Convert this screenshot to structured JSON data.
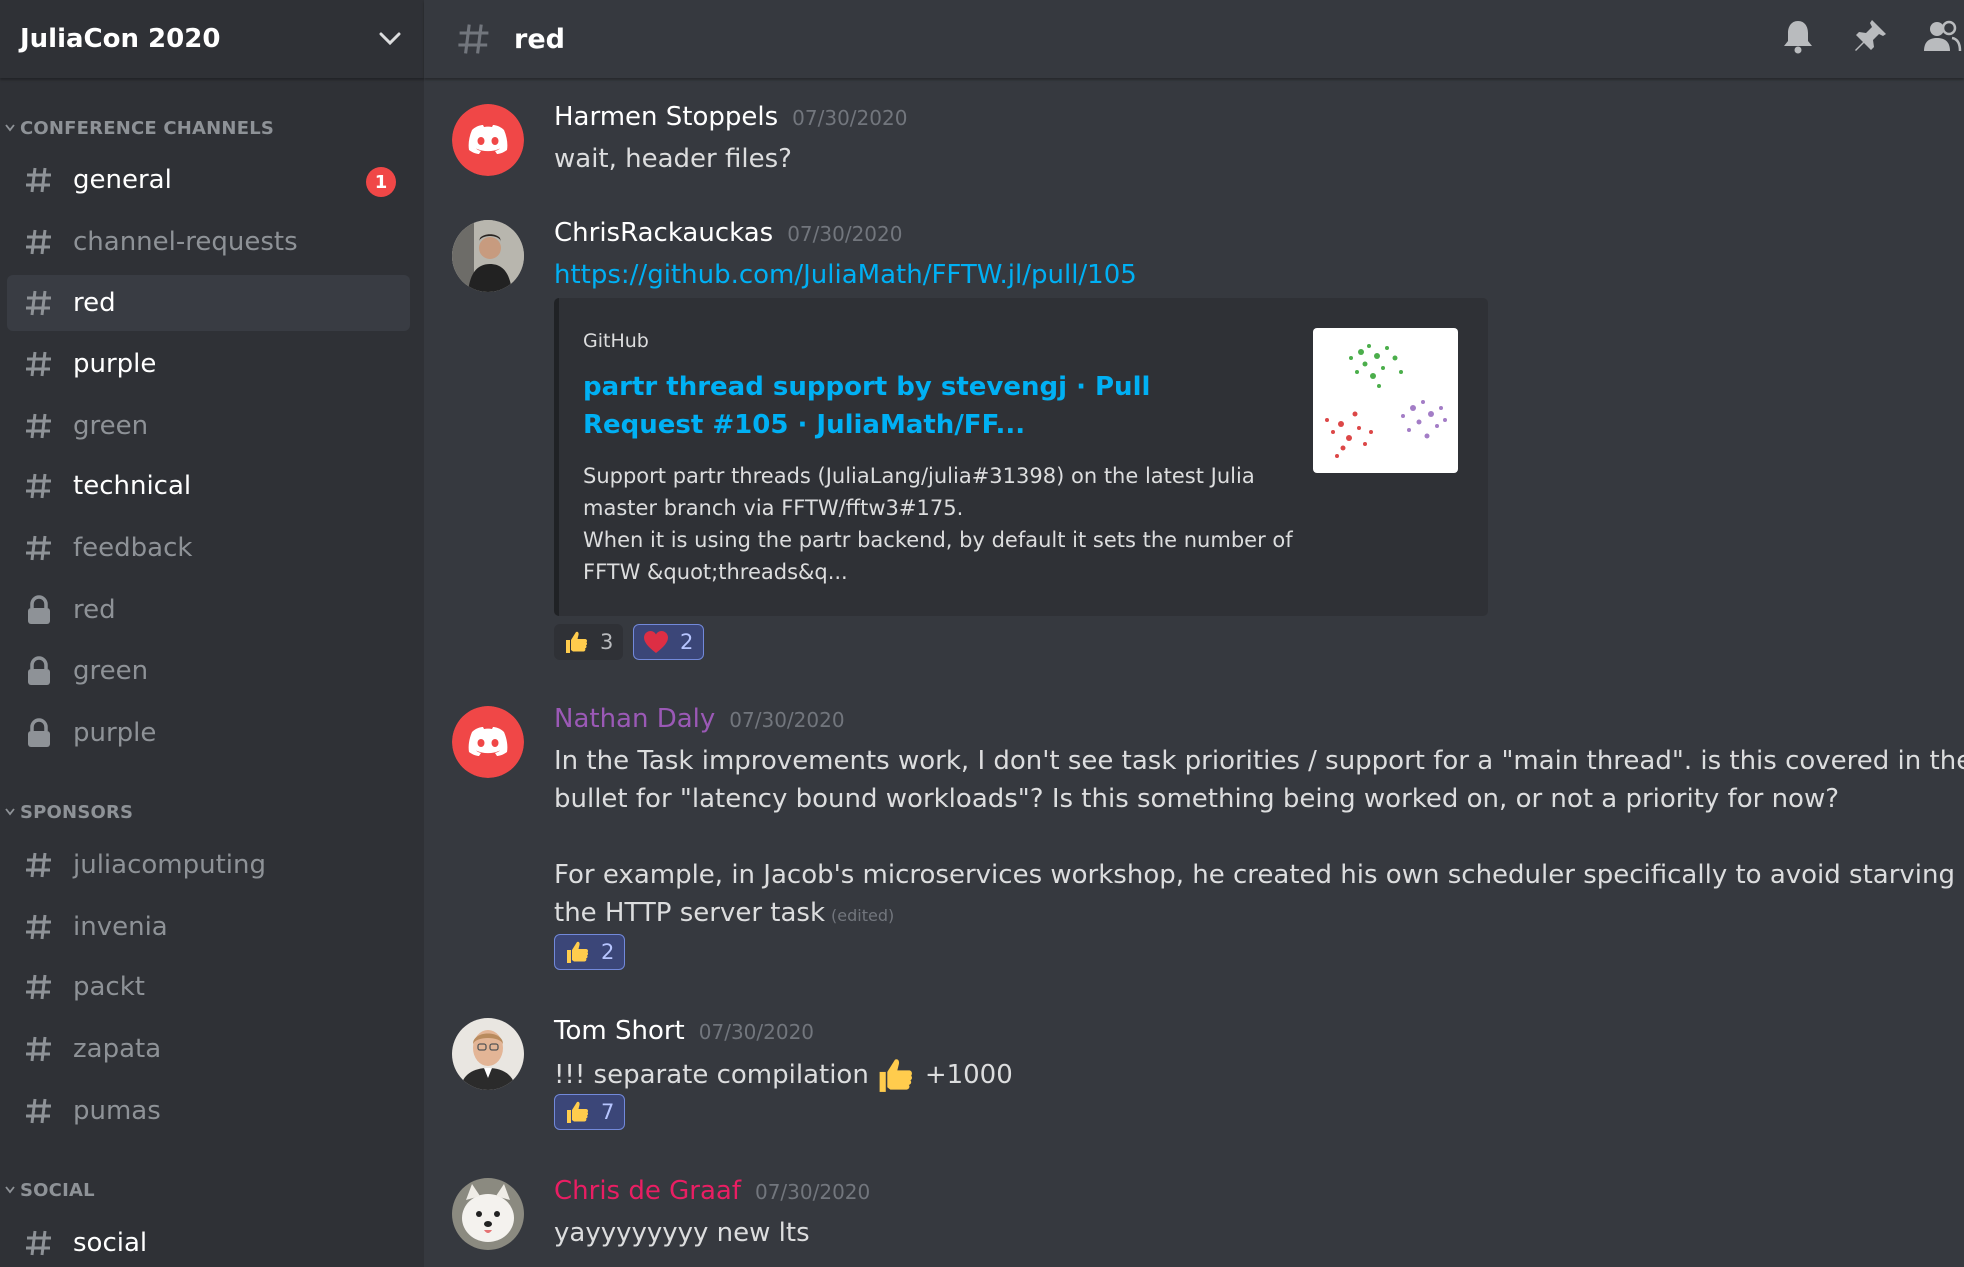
{
  "server": {
    "name": "JuliaCon 2020"
  },
  "sidebar": {
    "categories": [
      {
        "label": "CONFERENCE CHANNELS",
        "channels": [
          {
            "name": "general",
            "icon": "hash-icon",
            "badge": "1"
          },
          {
            "name": "channel-requests",
            "icon": "hash-icon"
          },
          {
            "name": "red",
            "icon": "hash-icon",
            "active": true
          },
          {
            "name": "purple",
            "icon": "hash-icon"
          },
          {
            "name": "green",
            "icon": "hash-icon"
          },
          {
            "name": "technical",
            "icon": "hash-icon"
          },
          {
            "name": "feedback",
            "icon": "hash-icon"
          },
          {
            "name": "red",
            "icon": "lock-icon"
          },
          {
            "name": "green",
            "icon": "lock-icon"
          },
          {
            "name": "purple",
            "icon": "lock-icon"
          }
        ]
      },
      {
        "label": "SPONSORS",
        "channels": [
          {
            "name": "juliacomputing",
            "icon": "hash-icon"
          },
          {
            "name": "invenia",
            "icon": "hash-icon"
          },
          {
            "name": "packt",
            "icon": "hash-icon"
          },
          {
            "name": "zapata",
            "icon": "hash-icon"
          },
          {
            "name": "pumas",
            "icon": "hash-icon"
          }
        ]
      },
      {
        "label": "SOCIAL",
        "channels": [
          {
            "name": "social",
            "icon": "hash-icon"
          }
        ]
      }
    ]
  },
  "channel_header": {
    "name": "red",
    "icons": [
      "bell-icon",
      "pin-icon",
      "members-icon"
    ]
  },
  "messages": [
    {
      "author": "Harmen Stoppels",
      "author_color": "#ffffff",
      "avatar": "discord-default-avatar",
      "timestamp": "07/30/2020",
      "lines": [
        "wait, header files?"
      ]
    },
    {
      "author": "ChrisRackauckas",
      "author_color": "#ffffff",
      "avatar": "photo-avatar",
      "timestamp": "07/30/2020",
      "link": "https://github.com/JuliaMath/FFTW.jl/pull/105",
      "embed": {
        "provider": "GitHub",
        "title": "partr thread support by stevengj · Pull Request #105 · JuliaMath/FF...",
        "description": [
          "Support partr threads (JuliaLang/julia#31398) on the latest Julia",
          "master branch via FFTW/fftw3#175.",
          "When it is using the partr backend, by default it sets the number of",
          "FFTW &quot;threads&q..."
        ]
      },
      "reactions": [
        {
          "emoji": "thumbs-up-icon",
          "count": "3",
          "me": false
        },
        {
          "emoji": "heart-icon",
          "count": "2",
          "me": true
        }
      ]
    },
    {
      "author": "Nathan Daly",
      "author_color": "#9b59b6",
      "avatar": "discord-default-avatar",
      "timestamp": "07/30/2020",
      "lines": [
        "In the Task improvements work, I don't see task priorities / support for a \"main thread\". is this covered in the",
        "bullet for \"latency bound workloads\"? Is this something being worked on, or not a priority for now?",
        "",
        "For example, in Jacob's microservices workshop, he created his own scheduler specifically to avoid starving",
        "the HTTP server task"
      ],
      "edited": "(edited)",
      "reactions": [
        {
          "emoji": "thumbs-up-icon",
          "count": "2",
          "me": true
        }
      ]
    },
    {
      "author": "Tom Short",
      "author_color": "#ffffff",
      "avatar": "photo-avatar",
      "timestamp": "07/30/2020",
      "text_before": "!!! separate compilation",
      "inline_emoji": "thumbs-up-icon",
      "text_after": "+1000",
      "reactions": [
        {
          "emoji": "thumbs-up-icon",
          "count": "7",
          "me": true
        }
      ]
    },
    {
      "author": "Chris de Graaf",
      "author_color": "#e91e63",
      "avatar": "dog-photo-avatar",
      "timestamp": "07/30/2020",
      "lines": [
        "yayyyyyyyy new lts"
      ]
    }
  ],
  "colors": {
    "sidebar_bg": "#2f3136",
    "chat_bg": "#36393f",
    "link": "#00b0f4",
    "badge": "#f04747",
    "discord_red": "#f04747"
  }
}
